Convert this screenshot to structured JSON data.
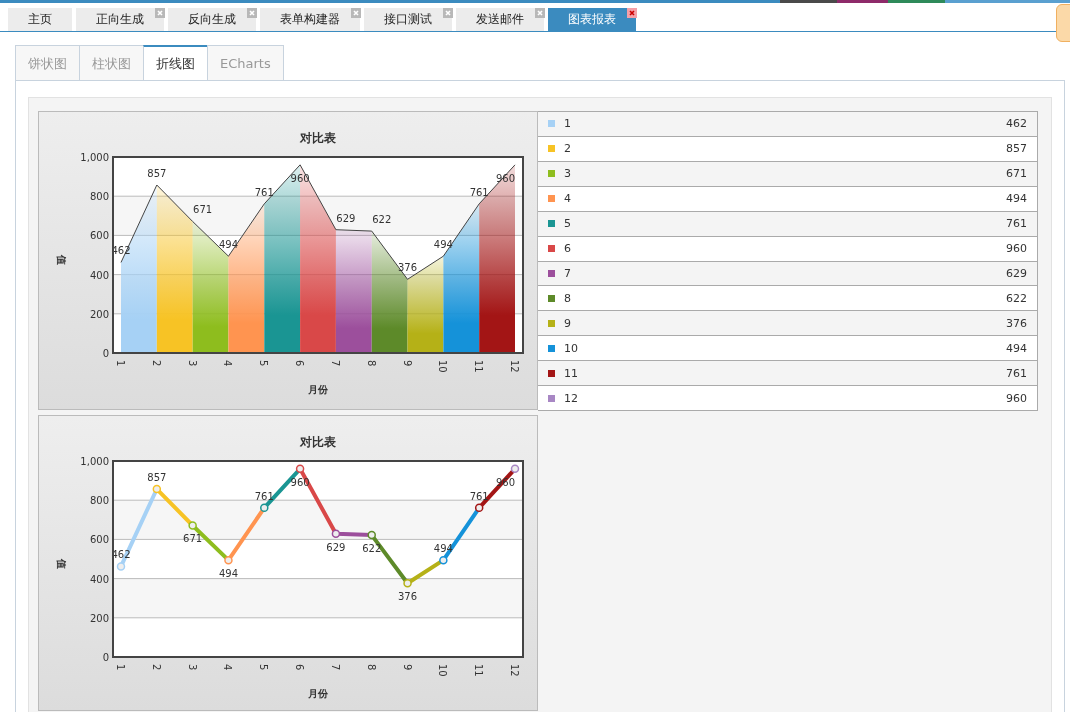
{
  "top_tabs": [
    {
      "label": "主页",
      "closable": false,
      "selected": false
    },
    {
      "label": "正向生成",
      "closable": true,
      "selected": false
    },
    {
      "label": "反向生成",
      "closable": true,
      "selected": false
    },
    {
      "label": "表单构建器",
      "closable": true,
      "selected": false
    },
    {
      "label": "接口测试",
      "closable": true,
      "selected": false
    },
    {
      "label": "发送邮件",
      "closable": true,
      "selected": false
    },
    {
      "label": "图表报表",
      "closable": true,
      "selected": true
    }
  ],
  "chart_tabs": [
    {
      "label": "饼状图",
      "selected": false
    },
    {
      "label": "柱状图",
      "selected": false
    },
    {
      "label": "折线图",
      "selected": true
    },
    {
      "label": "ECharts",
      "selected": false
    }
  ],
  "legend": {
    "items": [
      {
        "label": "1",
        "value": "462",
        "color": "#a6d1f5"
      },
      {
        "label": "2",
        "value": "857",
        "color": "#f7c325"
      },
      {
        "label": "3",
        "value": "671",
        "color": "#8ebd1e"
      },
      {
        "label": "4",
        "value": "494",
        "color": "#ff9450"
      },
      {
        "label": "5",
        "value": "761",
        "color": "#1a9593"
      },
      {
        "label": "6",
        "value": "960",
        "color": "#d94848"
      },
      {
        "label": "7",
        "value": "629",
        "color": "#9c4f9c"
      },
      {
        "label": "8",
        "value": "622",
        "color": "#5d8a29"
      },
      {
        "label": "9",
        "value": "376",
        "color": "#b5b117"
      },
      {
        "label": "10",
        "value": "494",
        "color": "#1592d9"
      },
      {
        "label": "11",
        "value": "761",
        "color": "#a31515"
      },
      {
        "label": "12",
        "value": "960",
        "color": "#a887c4"
      }
    ]
  },
  "charts": [
    {
      "chart_data": {
        "type": "area",
        "title": "对比表",
        "xlabel": "月份",
        "ylabel": "值",
        "categories": [
          "1",
          "2",
          "3",
          "4",
          "5",
          "6",
          "7",
          "8",
          "9",
          "10",
          "11",
          "12"
        ],
        "values": [
          462,
          857,
          671,
          494,
          761,
          960,
          629,
          622,
          376,
          494,
          761,
          960
        ],
        "ylim": [
          0,
          1000
        ],
        "yticks": [
          0,
          200,
          400,
          600,
          800,
          {
            "value": 1000,
            "label": "1,000"
          }
        ],
        "grid": true,
        "data_labels": true
      }
    },
    {
      "chart_data": {
        "type": "line",
        "title": "对比表",
        "xlabel": "月份",
        "ylabel": "值",
        "categories": [
          "1",
          "2",
          "3",
          "4",
          "5",
          "6",
          "7",
          "8",
          "9",
          "10",
          "11",
          "12"
        ],
        "values": [
          462,
          857,
          671,
          494,
          761,
          960,
          629,
          622,
          376,
          494,
          761,
          960
        ],
        "ylim": [
          0,
          1000
        ],
        "yticks": [
          0,
          200,
          400,
          600,
          800,
          {
            "value": 1000,
            "label": "1,000"
          }
        ],
        "grid": true,
        "marker": true,
        "data_labels": true
      }
    }
  ]
}
